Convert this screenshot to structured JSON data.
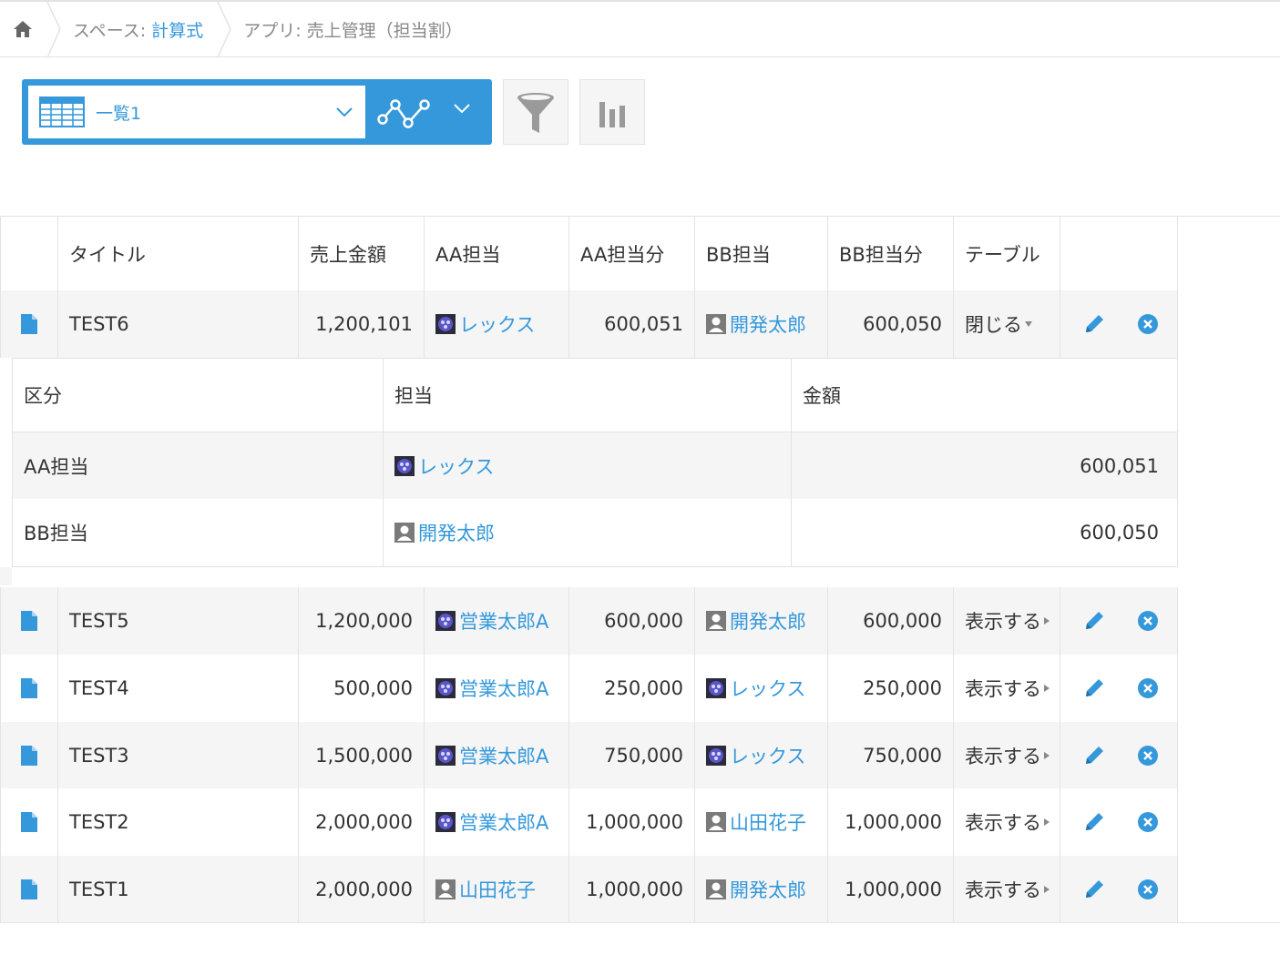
{
  "breadcrumb": {
    "space_prefix": "スペース: ",
    "space_name": "計算式",
    "app_label": "アプリ: 売上管理（担当割）"
  },
  "toolbar": {
    "view_name": "一覧1"
  },
  "table": {
    "columns": [
      "タイトル",
      "売上金額",
      "AA担当",
      "AA担当分",
      "BB担当",
      "BB担当分",
      "テーブル"
    ],
    "rows": [
      {
        "title": "TEST6",
        "amount": "1,200,101",
        "aa_user": "レックス",
        "aa_user_type": "org",
        "aa_share": "600,051",
        "bb_user": "開発太郎",
        "bb_user_type": "person",
        "bb_share": "600,050",
        "table_label": "閉じる"
      },
      {
        "title": "TEST5",
        "amount": "1,200,000",
        "aa_user": "営業太郎A",
        "aa_user_type": "org",
        "aa_share": "600,000",
        "bb_user": "開発太郎",
        "bb_user_type": "person",
        "bb_share": "600,000",
        "table_label": "表示する"
      },
      {
        "title": "TEST4",
        "amount": "500,000",
        "aa_user": "営業太郎A",
        "aa_user_type": "org",
        "aa_share": "250,000",
        "bb_user": "レックス",
        "bb_user_type": "org",
        "bb_share": "250,000",
        "table_label": "表示する"
      },
      {
        "title": "TEST3",
        "amount": "1,500,000",
        "aa_user": "営業太郎A",
        "aa_user_type": "org",
        "aa_share": "750,000",
        "bb_user": "レックス",
        "bb_user_type": "org",
        "bb_share": "750,000",
        "table_label": "表示する"
      },
      {
        "title": "TEST2",
        "amount": "2,000,000",
        "aa_user": "営業太郎A",
        "aa_user_type": "org",
        "aa_share": "1,000,000",
        "bb_user": "山田花子",
        "bb_user_type": "person",
        "bb_share": "1,000,000",
        "table_label": "表示する"
      },
      {
        "title": "TEST1",
        "amount": "2,000,000",
        "aa_user": "山田花子",
        "aa_user_type": "person",
        "aa_share": "1,000,000",
        "bb_user": "開発太郎",
        "bb_user_type": "person",
        "bb_share": "1,000,000",
        "table_label": "表示する"
      }
    ]
  },
  "subtable": {
    "columns": [
      "区分",
      "担当",
      "金額"
    ],
    "rows": [
      {
        "kubun": "AA担当",
        "user": "レックス",
        "user_type": "org",
        "amount": "600,051"
      },
      {
        "kubun": "BB担当",
        "user": "開発太郎",
        "user_type": "person",
        "amount": "600,050"
      }
    ]
  },
  "colors": {
    "accent": "#3498db",
    "border": "#e3e3e3",
    "row_alt": "#f5f5f5",
    "text": "#333333"
  },
  "icons": {
    "home": "home-icon",
    "view": "table-view-icon",
    "graph": "graph-icon",
    "filter": "filter-icon",
    "chart": "bar-chart-icon",
    "record": "document-icon",
    "edit": "pencil-icon",
    "delete": "delete-icon"
  }
}
